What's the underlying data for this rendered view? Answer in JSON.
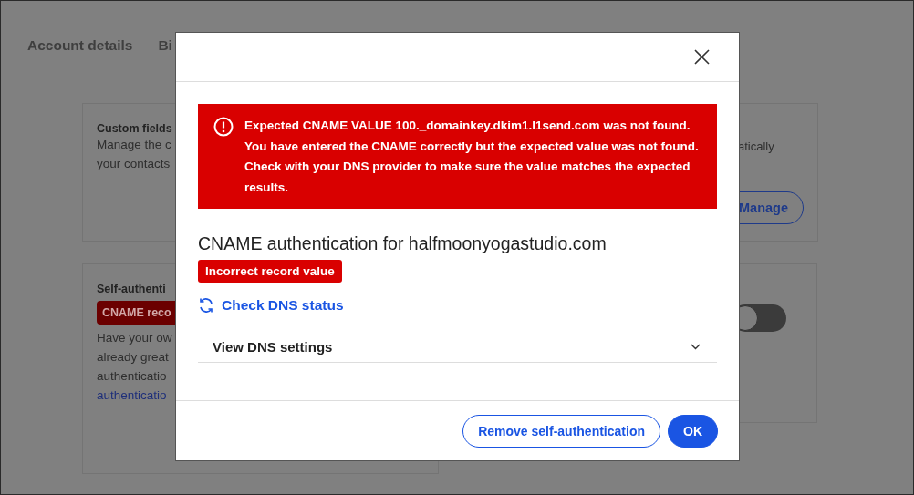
{
  "page": {
    "tabs": [
      {
        "label": "Account details"
      },
      {
        "label": "Bi"
      }
    ],
    "custom_fields": {
      "title": "Custom fields",
      "lines": [
        "Manage the c",
        "your contacts"
      ],
      "right_text": "atically",
      "manage_button": "Manage"
    },
    "self_auth": {
      "title": "Self-authenti",
      "badge": "CNAME reco",
      "lines": [
        "Have your ow",
        "already great",
        "authenticatio"
      ],
      "link": "authenticatio",
      "toggle": {
        "on": false
      }
    }
  },
  "modal": {
    "alert": {
      "message": "Expected CNAME VALUE 100._domainkey.dkim1.l1send.com was not found. You have entered the CNAME correctly but the expected value was not found. Check with your DNS provider to make sure the value matches the expected results."
    },
    "title": "CNAME authentication for halfmoonyogastudio.com",
    "status_badge": "Incorrect record value",
    "check_link": "Check DNS status",
    "dns_settings": {
      "label": "View DNS settings",
      "expanded": false
    },
    "buttons": [
      {
        "label": "Remove self-authentication",
        "kind": "secondary"
      },
      {
        "label": "OK",
        "kind": "primary"
      }
    ]
  }
}
